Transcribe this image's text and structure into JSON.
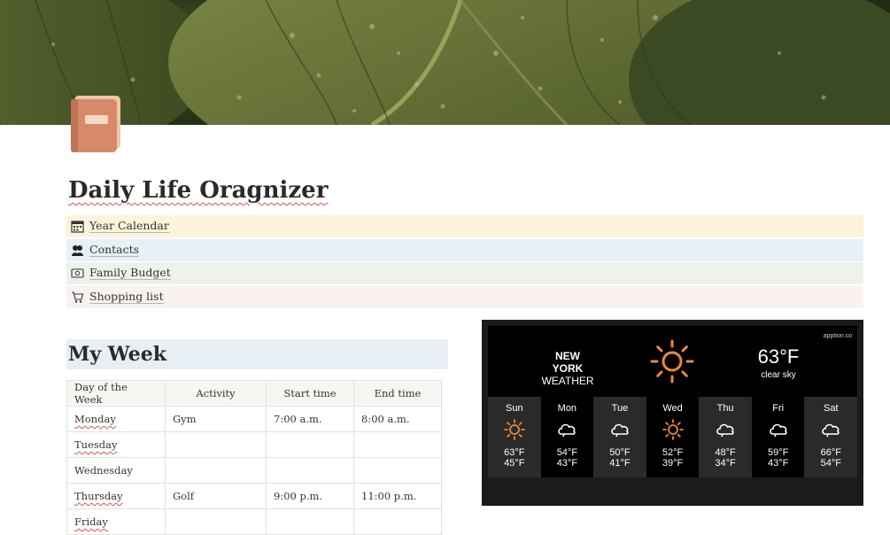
{
  "page": {
    "title": "Daily Life Oragnizer"
  },
  "links": [
    {
      "label": "Year Calendar",
      "icon": "calendar-icon",
      "bg": "#fbf3db"
    },
    {
      "label": "Contacts",
      "icon": "contacts-icon",
      "bg": "#e7f0f6"
    },
    {
      "label": "Family Budget",
      "icon": "money-icon",
      "bg": "#edf3ec"
    },
    {
      "label": "Shopping list",
      "icon": "cart-icon",
      "bg": "#faf1f1"
    }
  ],
  "week": {
    "heading": "My Week",
    "columns": [
      "Day of the Week",
      "Activity",
      "Start time",
      "End time"
    ],
    "rows": [
      {
        "day": "Monday",
        "activity": "Gym",
        "start": "7:00 a.m.",
        "end": "8:00 a.m."
      },
      {
        "day": "Tuesday",
        "activity": "",
        "start": "",
        "end": ""
      },
      {
        "day": "Wednesday",
        "activity": "",
        "start": "",
        "end": ""
      },
      {
        "day": "Thursday",
        "activity": "Golf",
        "start": "9:00 p.m.",
        "end": "11:00 p.m."
      },
      {
        "day": "Friday",
        "activity": "",
        "start": "",
        "end": ""
      }
    ]
  },
  "weather": {
    "brand": "apption.co",
    "city": "NEW YORK",
    "subtitle": "WEATHER",
    "current_temp": "63°F",
    "current_desc": "clear sky",
    "current_icon": "sun-icon",
    "days": [
      {
        "name": "Sun",
        "icon": "sun-icon",
        "hi": "63°F",
        "lo": "45°F"
      },
      {
        "name": "Mon",
        "icon": "cloud-icon",
        "hi": "54°F",
        "lo": "43°F"
      },
      {
        "name": "Tue",
        "icon": "cloud-icon",
        "hi": "50°F",
        "lo": "41°F"
      },
      {
        "name": "Wed",
        "icon": "sun-icon",
        "hi": "52°F",
        "lo": "39°F"
      },
      {
        "name": "Thu",
        "icon": "cloud-icon",
        "hi": "48°F",
        "lo": "34°F"
      },
      {
        "name": "Fri",
        "icon": "cloud-icon",
        "hi": "59°F",
        "lo": "43°F"
      },
      {
        "name": "Sat",
        "icon": "cloud-icon",
        "hi": "66°F",
        "lo": "54°F"
      }
    ],
    "colors": {
      "sun": "#e8893a",
      "widget_bg": "#1b1b1b"
    }
  }
}
